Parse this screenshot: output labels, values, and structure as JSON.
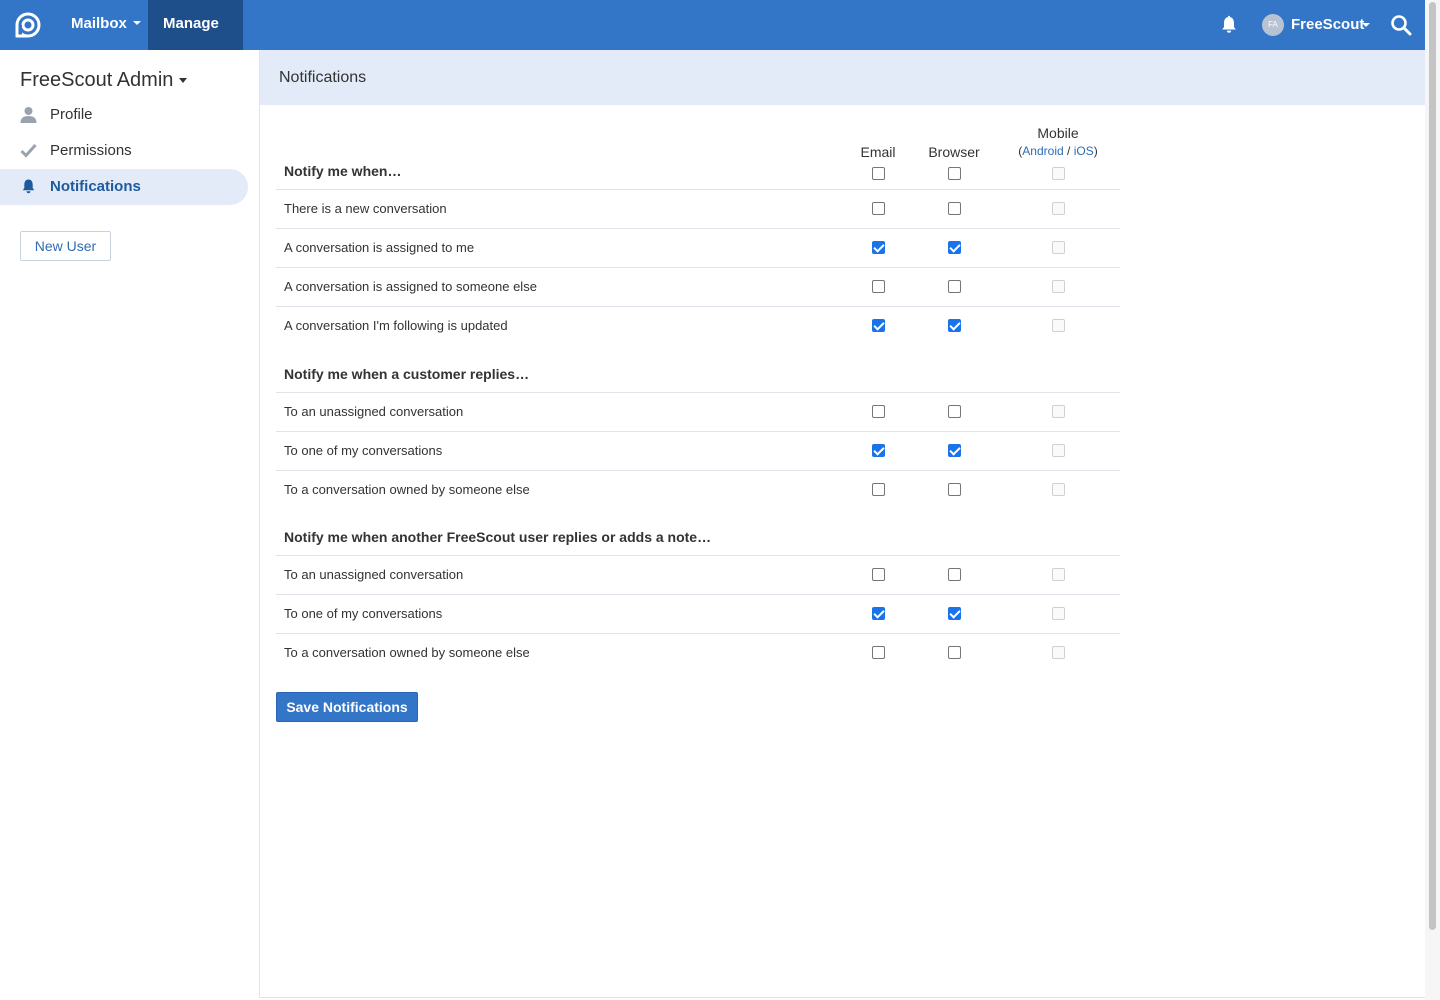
{
  "topnav": {
    "mailbox_label": "Mailbox",
    "manage_label": "Manage",
    "user_initials": "FA",
    "user_name": "FreeScout",
    "icons": [
      "freescout-logo-icon",
      "bell-icon",
      "search-icon"
    ],
    "colors": {
      "bar": "#3375c7",
      "active": "#1f4f8a"
    }
  },
  "sidebar": {
    "title": "FreeScout Admin",
    "items": [
      {
        "label": "Profile",
        "icon": "user-icon"
      },
      {
        "label": "Permissions",
        "icon": "check-icon"
      },
      {
        "label": "Notifications",
        "icon": "bell-icon",
        "active": true
      }
    ],
    "new_user_label": "New User"
  },
  "main": {
    "title": "Notifications",
    "columns": {
      "email": "Email",
      "browser": "Browser",
      "mobile": "Mobile",
      "mobile_paren_open": "(",
      "mobile_android": "Android",
      "mobile_sep": " / ",
      "mobile_ios": "iOS",
      "mobile_paren_close": ")"
    },
    "sections": [
      {
        "title": "Notify me when…",
        "header_checks": {
          "email": false,
          "browser": false,
          "mobile": false
        },
        "rows": [
          {
            "label": "There is a new conversation",
            "email": false,
            "browser": false,
            "mobile": false
          },
          {
            "label": "A conversation is assigned to me",
            "email": true,
            "browser": true,
            "mobile": false
          },
          {
            "label": "A conversation is assigned to someone else",
            "email": false,
            "browser": false,
            "mobile": false
          },
          {
            "label": "A conversation I'm following is updated",
            "email": true,
            "browser": true,
            "mobile": false
          }
        ]
      },
      {
        "title": "Notify me when a customer replies…",
        "rows": [
          {
            "label": "To an unassigned conversation",
            "email": false,
            "browser": false,
            "mobile": false
          },
          {
            "label": "To one of my conversations",
            "email": true,
            "browser": true,
            "mobile": false
          },
          {
            "label": "To a conversation owned by someone else",
            "email": false,
            "browser": false,
            "mobile": false
          }
        ]
      },
      {
        "title": "Notify me when another FreeScout user replies or adds a note…",
        "rows": [
          {
            "label": "To an unassigned conversation",
            "email": false,
            "browser": false,
            "mobile": false
          },
          {
            "label": "To one of my conversations",
            "email": true,
            "browser": true,
            "mobile": false
          },
          {
            "label": "To a conversation owned by someone else",
            "email": false,
            "browser": false,
            "mobile": false
          }
        ]
      }
    ],
    "save_label": "Save Notifications"
  }
}
